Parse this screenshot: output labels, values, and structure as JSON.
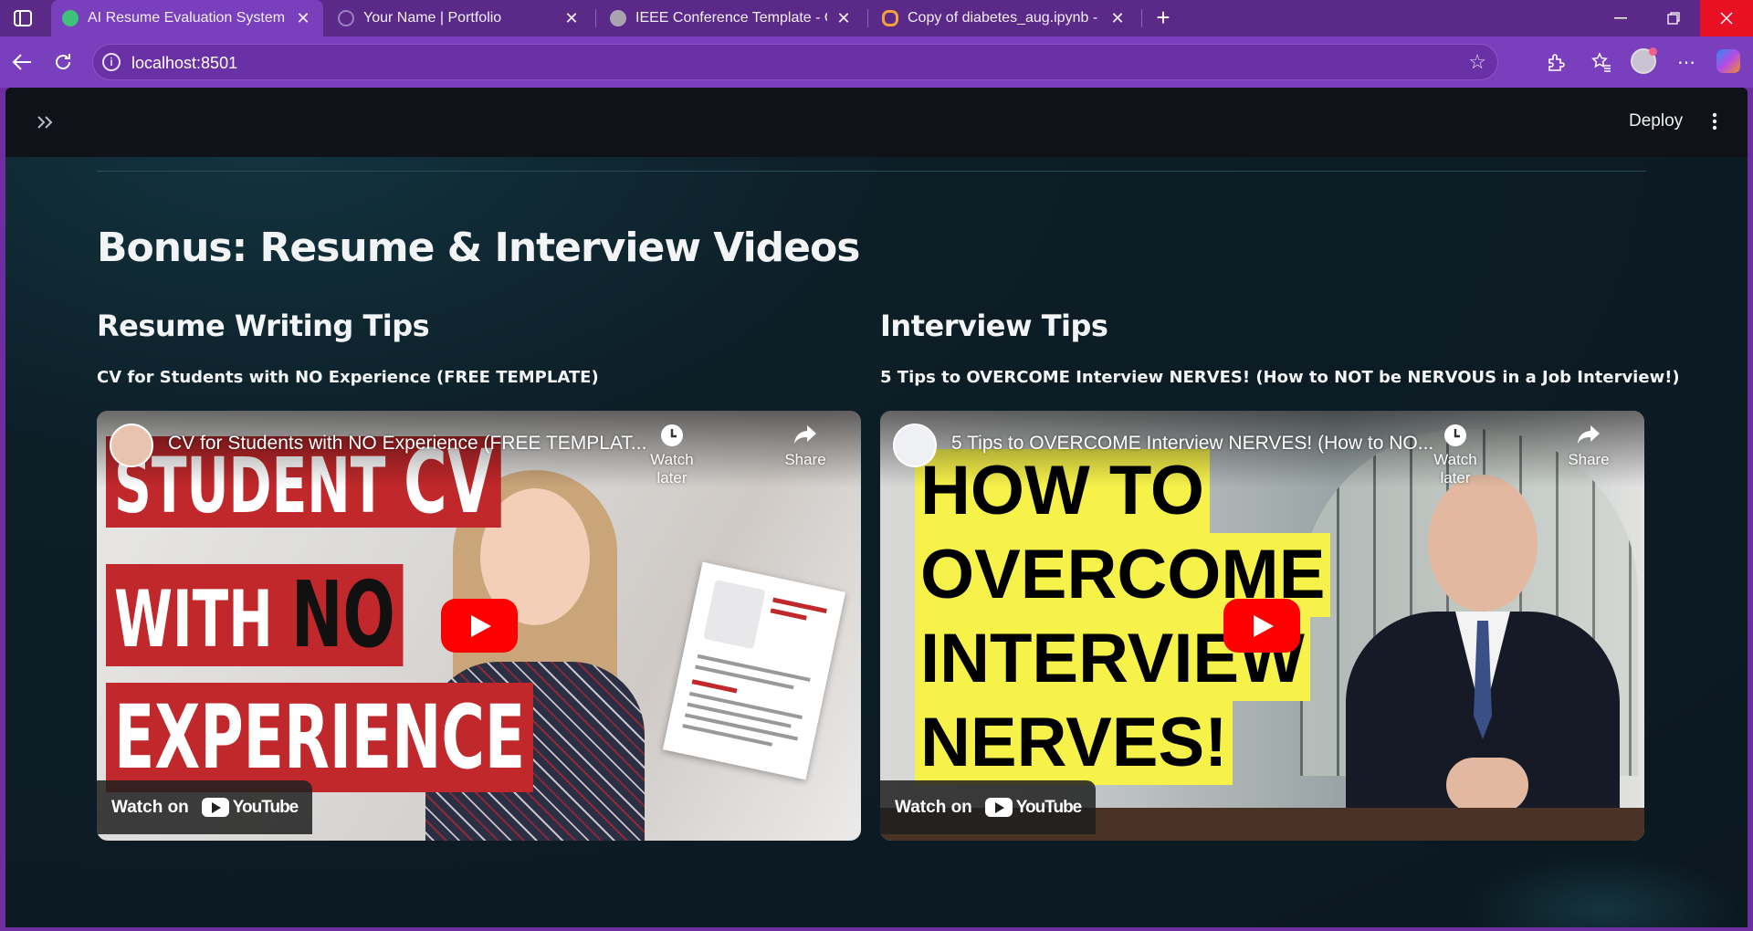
{
  "browser": {
    "tabs": [
      {
        "label": "AI Resume Evaluation System",
        "favicon_color": "#3ec27a",
        "active": true
      },
      {
        "label": "Your Name | Portfolio",
        "favicon_color": "#9b7fc2",
        "active": false
      },
      {
        "label": "IEEE Conference Template - Online",
        "favicon_color": "#a9a3b0",
        "active": false
      },
      {
        "label": "Copy of diabetes_aug.ipynb - Col",
        "favicon_color": "#f3a13a",
        "active": false
      }
    ],
    "close_glyph": "✕",
    "new_tab_glyph": "+",
    "url": "localhost:8501"
  },
  "app": {
    "deploy_label": "Deploy",
    "section_title": "Bonus: Resume & Interview Videos",
    "columns": [
      {
        "heading": "Resume Writing Tips",
        "video_title": "CV for Students with NO Experience (FREE TEMPLATE)",
        "player": {
          "headline": "CV for Students with NO Experience (FREE TEMPLAT...",
          "watch_later": "Watch later",
          "share": "Share",
          "watch_on": "Watch on",
          "brand": "YouTube",
          "thumb_lines": [
            "STUDENT",
            "CV",
            "WITH",
            "NO",
            "EXPERIENCE"
          ]
        }
      },
      {
        "heading": "Interview Tips",
        "video_title": "5 Tips to OVERCOME Interview NERVES! (How to NOT be NERVOUS in a Job Interview!)",
        "player": {
          "headline": "5 Tips to OVERCOME Interview NERVES! (How to NO...",
          "watch_later": "Watch later",
          "share": "Share",
          "watch_on": "Watch on",
          "brand": "YouTube",
          "thumb_lines": [
            "HOW TO",
            "OVERCOME",
            "INTERVIEW",
            "NERVES!"
          ]
        }
      }
    ]
  },
  "colors": {
    "browser_frame": "#7a3fbd",
    "app_bg": "#0b1820",
    "accent_red": "#ff0000",
    "thumb_yellow": "#f7f24a"
  }
}
